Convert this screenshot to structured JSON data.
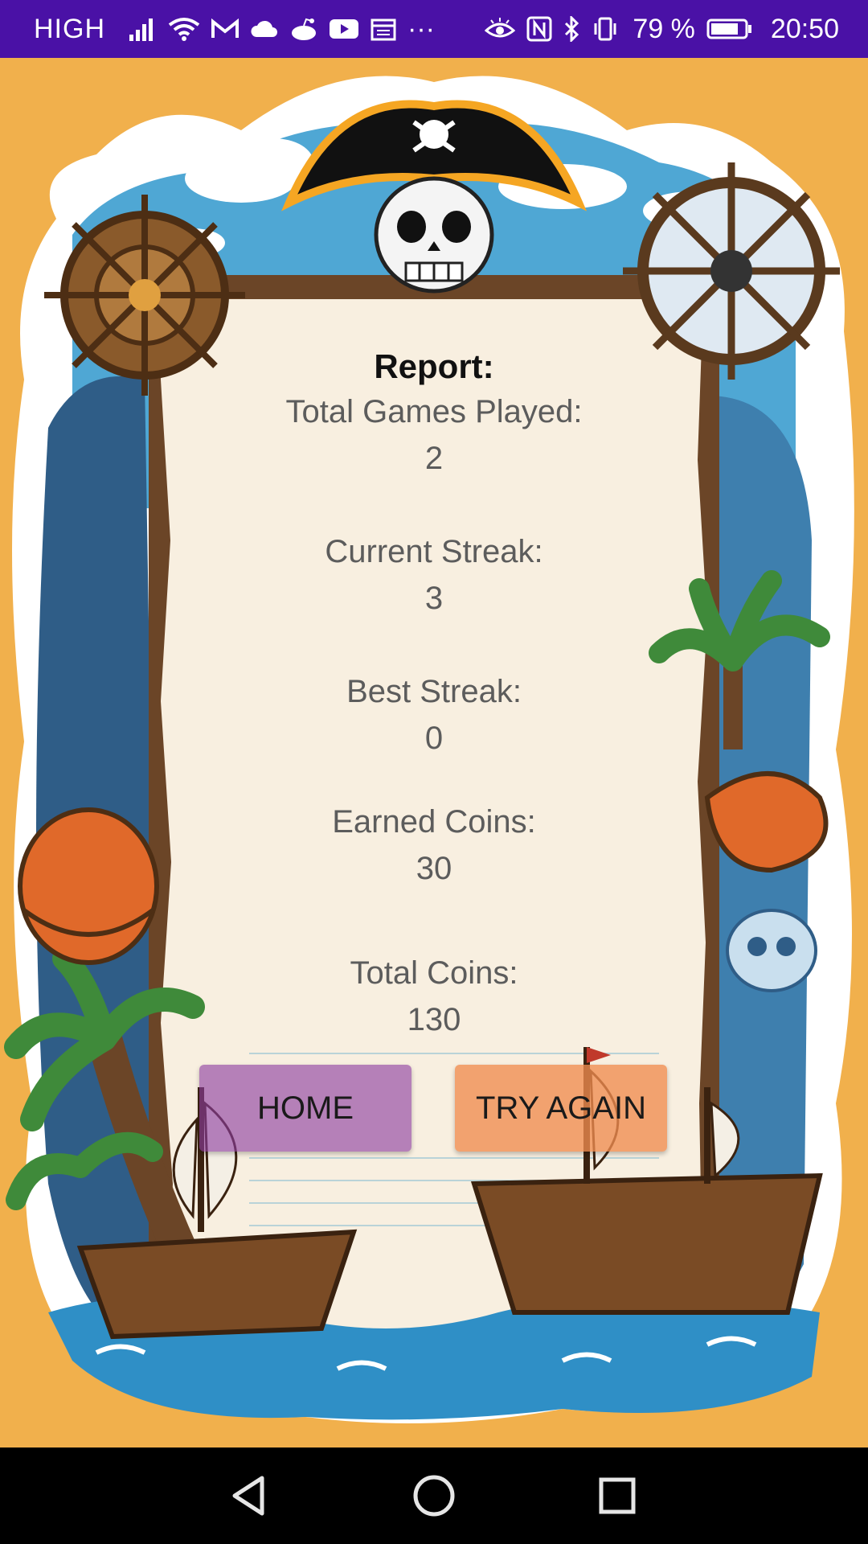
{
  "status_bar": {
    "network_label": "HIGH",
    "battery_percent": "79 %",
    "time": "20:50",
    "more_label": "···",
    "icons": [
      "signal-icon",
      "wifi-icon",
      "gmail-icon",
      "cloud-icon",
      "reddit-icon",
      "youtube-icon",
      "calendar-icon",
      "eye-comfort-icon",
      "nfc-icon",
      "bluetooth-icon",
      "vibrate-icon",
      "battery-icon"
    ]
  },
  "report": {
    "title": "Report:",
    "stats": [
      {
        "label": "Total Games Played:",
        "value": "2"
      },
      {
        "label": "Current Streak:",
        "value": "3"
      },
      {
        "label": "Best Streak:",
        "value": "0"
      },
      {
        "label": "Earned Coins:",
        "value": "30"
      },
      {
        "label": "Total Coins:",
        "value": "130"
      }
    ]
  },
  "buttons": {
    "home_label": "HOME",
    "try_again_label": "TRY AGAIN"
  },
  "colors": {
    "status_bar": "#4a11a6",
    "background": "#f1b04c",
    "parchment": "#f8efe0",
    "home_button": "#8c3ca0",
    "try_again_button": "#f08c50"
  }
}
